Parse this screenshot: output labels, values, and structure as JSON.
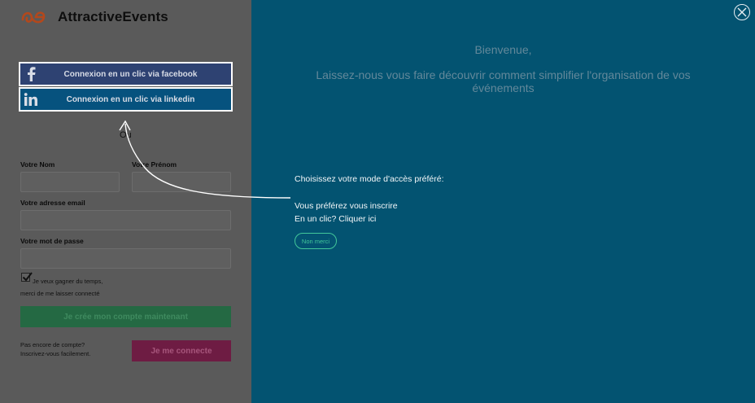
{
  "brand": {
    "name": "AttractiveEvents",
    "logo_icon": "ae-logo-icon",
    "logo_color": "#b3481c"
  },
  "social": {
    "facebook_label": "Connexion en un clic via facebook",
    "facebook_icon": "facebook-icon",
    "linkedin_label": "Connexion en un clic via linkedin",
    "linkedin_icon": "linkedin-icon"
  },
  "form": {
    "or_text": "Ou",
    "last_name_label": "Votre Nom",
    "first_name_label": "Votre Prénom",
    "email_label": "Votre adresse email",
    "password_label": "Votre mot de passe",
    "remember_line1": "Je veux gagner du temps,",
    "remember_line2": "merci de me laisser connecté",
    "remember_checked": true,
    "create_button": "Je crée mon compte maintenant",
    "no_account_line1": "Pas encore de compte?",
    "no_account_line2": "Inscrivez-vous facilement.",
    "login_button": "Je me connecte"
  },
  "overlay": {
    "welcome_title": "Bienvenue,",
    "welcome_text": "Laissez-nous vous faire découvrir comment simplifier l'organisation de vos événements",
    "choose_text": "Choisissez votre mode d'accès préféré:",
    "prefer_line1": "Vous préférez vous inscrire",
    "prefer_line2": "En un clic? Cliquer ici",
    "no_thanks": "Non merci",
    "close_icon": "close-icon",
    "accent": "#42c79a",
    "background": "#035371"
  }
}
